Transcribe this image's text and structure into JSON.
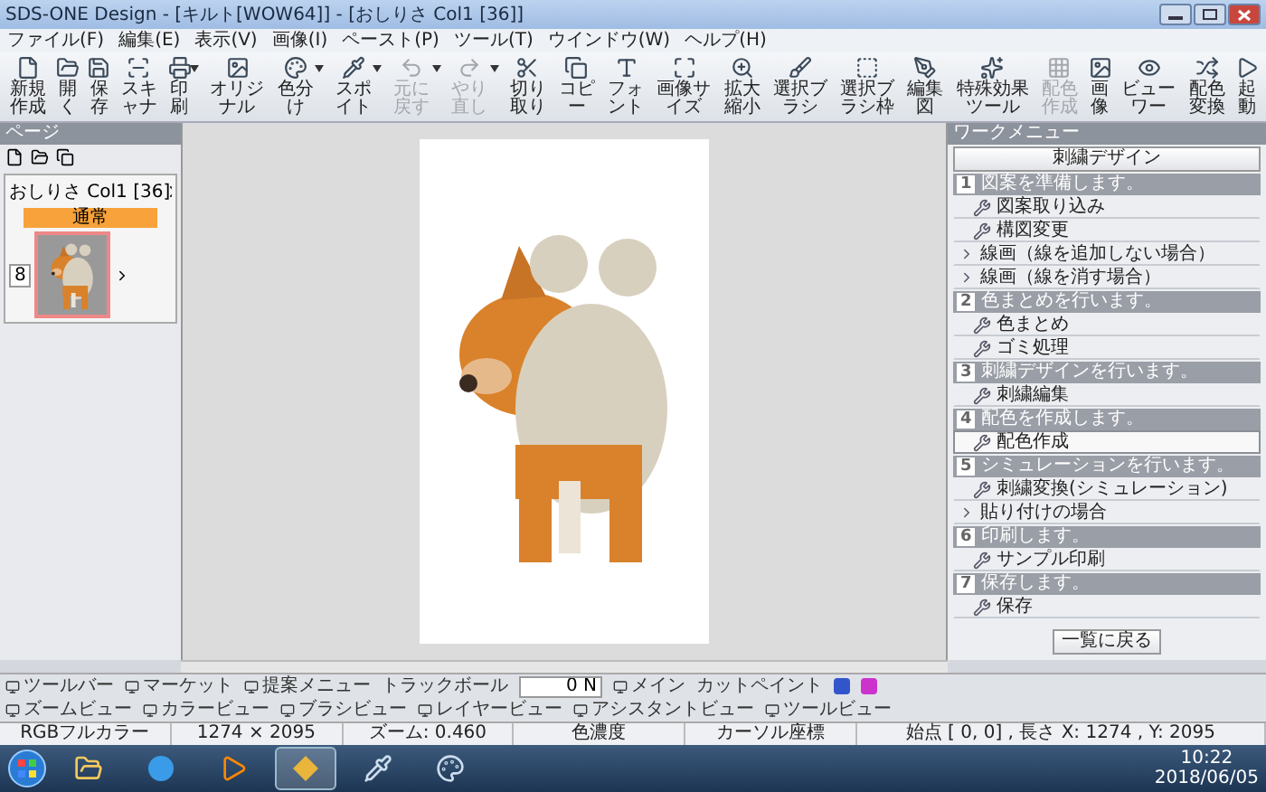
{
  "window": {
    "title": "SDS-ONE Design - [キルト[WOW64]] - [おしりさ Col1 [36]]"
  },
  "menu": [
    "ファイル(F)",
    "編集(E)",
    "表示(V)",
    "画像(I)",
    "ペースト(P)",
    "ツール(T)",
    "ウインドウ(W)",
    "ヘルプ(H)"
  ],
  "toolbar": [
    {
      "label": "新規作成",
      "disabled": false,
      "dropdown": false
    },
    {
      "label": "開く",
      "disabled": false,
      "dropdown": false
    },
    {
      "label": "保存",
      "disabled": false,
      "dropdown": false
    },
    {
      "label": "スキャナ",
      "disabled": false,
      "dropdown": false
    },
    {
      "label": "印刷",
      "disabled": false,
      "dropdown": true
    },
    {
      "label": "オリジナル",
      "disabled": false,
      "dropdown": false
    },
    {
      "label": "色分け",
      "disabled": false,
      "dropdown": true
    },
    {
      "label": "スポイト",
      "disabled": false,
      "dropdown": true
    },
    {
      "label": "元に戻す",
      "disabled": true,
      "dropdown": true
    },
    {
      "label": "やり直し",
      "disabled": true,
      "dropdown": true
    },
    {
      "label": "切り取り",
      "disabled": false,
      "dropdown": false
    },
    {
      "label": "コピー",
      "disabled": false,
      "dropdown": false
    },
    {
      "label": "フォント",
      "disabled": false,
      "dropdown": false
    },
    {
      "label": "画像サイズ",
      "disabled": false,
      "dropdown": false
    },
    {
      "label": "拡大縮小",
      "disabled": false,
      "dropdown": false
    },
    {
      "label": "選択ブラシ",
      "disabled": false,
      "dropdown": false
    },
    {
      "label": "選択ブラシ枠",
      "disabled": false,
      "dropdown": false
    },
    {
      "label": "編集図",
      "disabled": false,
      "dropdown": false
    },
    {
      "label": "特殊効果ツール",
      "disabled": false,
      "dropdown": false
    },
    {
      "label": "配色作成",
      "disabled": true,
      "dropdown": false
    },
    {
      "label": "画像",
      "disabled": false,
      "dropdown": false
    },
    {
      "label": "ビューワー",
      "disabled": false,
      "dropdown": false
    },
    {
      "label": "配色変換",
      "disabled": false,
      "dropdown": false
    },
    {
      "label": "起動",
      "disabled": false,
      "dropdown": false
    }
  ],
  "page_panel": {
    "title": "ページ",
    "document": {
      "title": "おしりさ Col1 [36]",
      "tag": "通常",
      "count": "8"
    }
  },
  "work_menu": {
    "title": "ワークメニュー",
    "top_button": "刺繍デザイン",
    "back_button": "一覧に戻る",
    "sections": [
      {
        "number": "1",
        "title": "図案を準備します。",
        "items": [
          {
            "kind": "tool",
            "label": "図案取り込み",
            "selected": false
          },
          {
            "kind": "tool",
            "label": "構図変更",
            "selected": false
          },
          {
            "kind": "link",
            "label": "線画（線を追加しない場合）",
            "selected": false
          },
          {
            "kind": "link",
            "label": "線画（線を消す場合）",
            "selected": false
          }
        ]
      },
      {
        "number": "2",
        "title": "色まとめを行います。",
        "items": [
          {
            "kind": "tool",
            "label": "色まとめ",
            "selected": false
          },
          {
            "kind": "tool",
            "label": "ゴミ処理",
            "selected": false
          }
        ]
      },
      {
        "number": "3",
        "title": "刺繍デザインを行います。",
        "items": [
          {
            "kind": "tool",
            "label": "刺繍編集",
            "selected": false
          }
        ]
      },
      {
        "number": "4",
        "title": "配色を作成します。",
        "items": [
          {
            "kind": "tool",
            "label": "配色作成",
            "selected": true
          }
        ]
      },
      {
        "number": "5",
        "title": "シミュレーションを行います。",
        "items": [
          {
            "kind": "tool",
            "label": "刺繍変換(シミュレーション)",
            "selected": false
          },
          {
            "kind": "link",
            "label": "貼り付けの場合",
            "selected": false
          }
        ]
      },
      {
        "number": "6",
        "title": "印刷します。",
        "items": [
          {
            "kind": "tool",
            "label": "サンプル印刷",
            "selected": false
          }
        ]
      },
      {
        "number": "7",
        "title": "保存します。",
        "items": [
          {
            "kind": "tool",
            "label": "保存",
            "selected": false
          }
        ]
      }
    ]
  },
  "view_bar": {
    "left": [
      {
        "kind": "view",
        "label": "ツールバー"
      },
      {
        "kind": "view",
        "label": "マーケット"
      },
      {
        "kind": "view",
        "label": "提案メニュー"
      },
      {
        "kind": "text",
        "label": "トラックボール"
      },
      {
        "kind": "field",
        "label": "0 N"
      },
      {
        "kind": "view",
        "label": "メイン"
      },
      {
        "kind": "text",
        "label": "カットペイント"
      }
    ],
    "right": [
      {
        "kind": "view",
        "label": "ズームビュー"
      },
      {
        "kind": "view",
        "label": "カラービュー"
      },
      {
        "kind": "view",
        "label": "ブラシビュー"
      },
      {
        "kind": "view",
        "label": "レイヤービュー"
      },
      {
        "kind": "view",
        "label": "アシスタントビュー"
      },
      {
        "kind": "view",
        "label": "ツールビュー"
      }
    ]
  },
  "status_bar": [
    "RGBフルカラー",
    "1274 × 2095",
    "ズーム: 0.460",
    "色濃度",
    "カーソル座標",
    "始点 [ 0, 0] , 長さ X: 1274 , Y: 2095"
  ],
  "taskbar": {
    "time": "10:22",
    "date": "2018/06/05"
  }
}
